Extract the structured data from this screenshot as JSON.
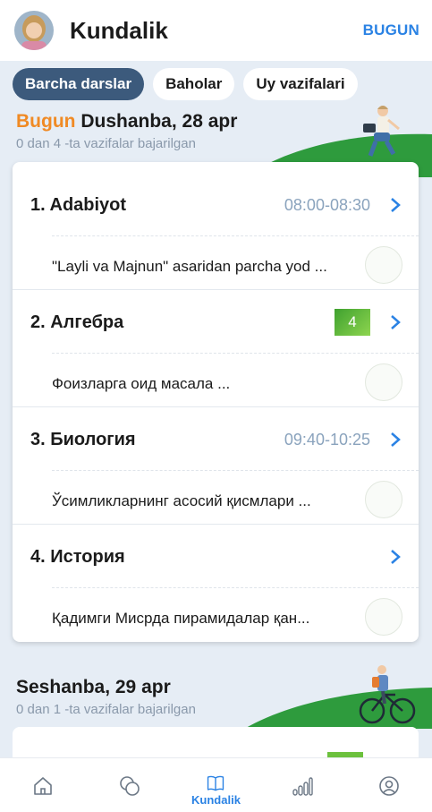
{
  "header": {
    "title": "Kundalik",
    "today_button": "BUGUN"
  },
  "filters": [
    {
      "label": "Barcha darslar",
      "active": true
    },
    {
      "label": "Baholar",
      "active": false
    },
    {
      "label": "Uy vazifalari",
      "active": false
    }
  ],
  "days": [
    {
      "today_word": "Bugun",
      "date": "Dushanba, 28 apr",
      "summary": "0 dan 4 -ta vazifalar bajarilgan",
      "lessons": [
        {
          "name": "1. Adabiyot",
          "time": "08:00-08:30",
          "grade": "",
          "task": "\"Layli va Majnun\" asaridan parcha yod ..."
        },
        {
          "name": "2. Алгебра",
          "time": "",
          "grade": "4",
          "task": "Фоизларга оид масала ..."
        },
        {
          "name": "3. Биология",
          "time": "09:40-10:25",
          "grade": "",
          "task": "Ўсимликларнинг асосий қисмлари ..."
        },
        {
          "name": "4. История",
          "time": "",
          "grade": "",
          "task": "Қадимги Мисрда пирамидалар қан..."
        }
      ]
    },
    {
      "date": "Seshanba, 29 apr",
      "summary": "0 dan 1 -ta vazifalar bajarilgan"
    }
  ],
  "nav": [
    {
      "icon": "home-icon",
      "label": ""
    },
    {
      "icon": "chat-icon",
      "label": ""
    },
    {
      "icon": "book-icon",
      "label": "Kundalik",
      "active": true
    },
    {
      "icon": "stats-icon",
      "label": ""
    },
    {
      "icon": "profile-icon",
      "label": ""
    }
  ],
  "colors": {
    "accent": "#2a82e4",
    "today": "#f08a24",
    "chip_active": "#3c5a7c",
    "grade": "#5cb531"
  }
}
